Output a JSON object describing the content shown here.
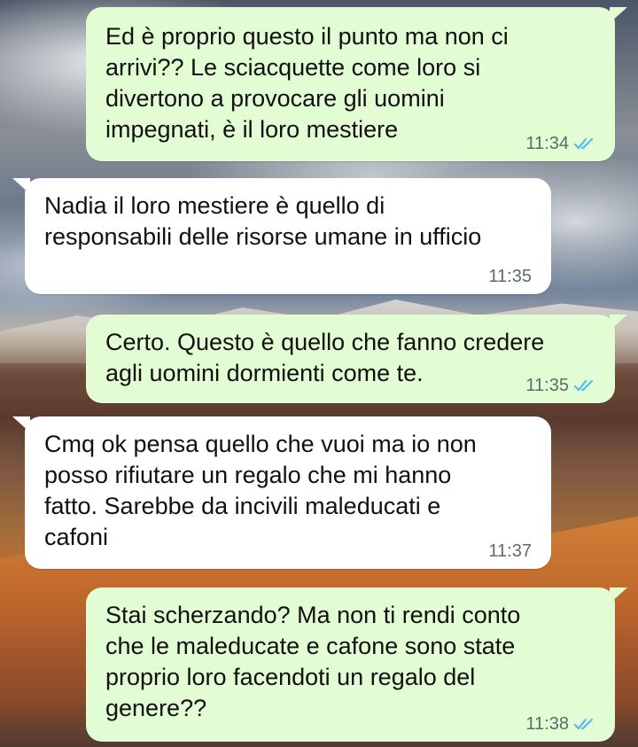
{
  "messages": [
    {
      "direction": "out",
      "text": "Ed è proprio questo il punto ma non ci\narrivi?? Le sciacquette come loro si\ndivertono a provocare gli uomini\nimpegnati, è il loro mestiere",
      "time": "11:34",
      "status": "read"
    },
    {
      "direction": "in",
      "text": "Nadia il loro mestiere è quello di\nresponsabili delle risorse umane in ufficio",
      "time": "11:35"
    },
    {
      "direction": "out",
      "text": "Certo. Questo è quello che fanno credere\nagli uomini dormienti come te.",
      "time": "11:35",
      "status": "read"
    },
    {
      "direction": "in",
      "text": "Cmq ok pensa quello che vuoi ma io non\nposso rifiutare un regalo che mi hanno\nfatto. Sarebbe da incivili maleducati e\ncafoni",
      "time": "11:37"
    },
    {
      "direction": "out",
      "text": "Stai scherzando? Ma non ti rendi conto\nche le maleducate e cafone sono state\nproprio loro facendoti un regalo del\ngenere??",
      "time": "11:38",
      "status": "read"
    }
  ],
  "colors": {
    "outgoing_bubble": "#e2fcd3",
    "incoming_bubble": "#ffffff",
    "read_ticks": "#53bdeb",
    "timestamp": "#5f6b66"
  },
  "icons": {
    "read_receipt": "double-check-icon"
  }
}
